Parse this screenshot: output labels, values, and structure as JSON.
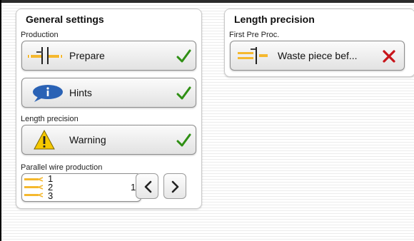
{
  "general_settings": {
    "title": "General settings",
    "production": {
      "label": "Production",
      "value": "Prepare",
      "status": "ok"
    },
    "hints": {
      "value": "Hints",
      "status": "ok"
    },
    "length_precision": {
      "label": "Length precision",
      "value": "Warning",
      "status": "ok"
    },
    "parallel_wire": {
      "label": "Parallel wire production",
      "icon_numbers": [
        "1",
        "2",
        "3"
      ],
      "value": "1"
    }
  },
  "length_precision_panel": {
    "title": "Length precision",
    "first_pre_proc": {
      "label": "First Pre Proc.",
      "value": "Waste piece bef...",
      "status": "error"
    }
  },
  "colors": {
    "ok": "#2f8f14",
    "error": "#c8141a",
    "wire": "#f5b82e"
  }
}
